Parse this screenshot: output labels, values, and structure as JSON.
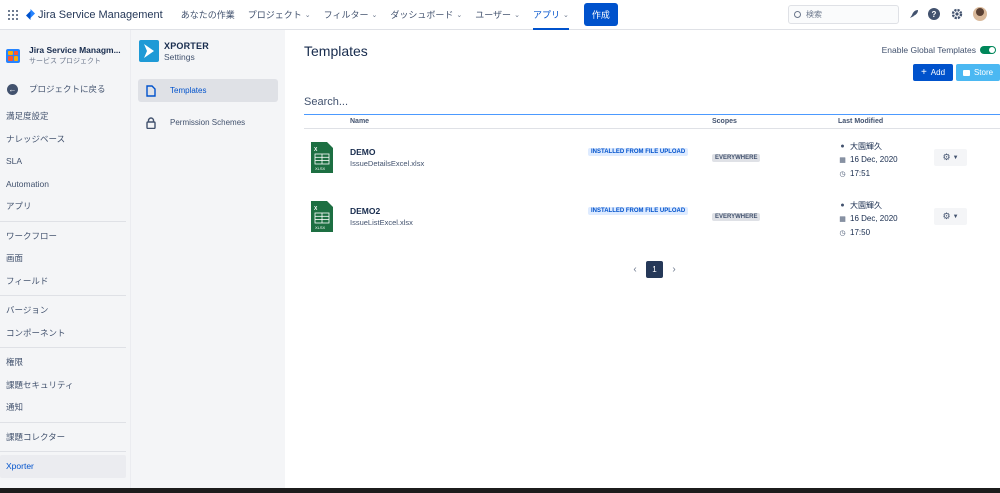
{
  "topbar": {
    "product_name": "Jira Service Management",
    "nav": [
      {
        "label": "あなたの作業",
        "chevron": false,
        "active": false
      },
      {
        "label": "プロジェクト",
        "chevron": true,
        "active": false
      },
      {
        "label": "フィルター",
        "chevron": true,
        "active": false
      },
      {
        "label": "ダッシュボード",
        "chevron": true,
        "active": false
      },
      {
        "label": "ユーザー",
        "chevron": true,
        "active": false
      },
      {
        "label": "アプリ",
        "chevron": true,
        "active": true
      }
    ],
    "create_label": "作成",
    "search_placeholder": "検索",
    "icons": [
      "apps-grid-icon",
      "rocket-icon",
      "help-icon",
      "settings-icon",
      "user-avatar"
    ]
  },
  "sidebar": {
    "project_name": "Jira Service Managm...",
    "project_type": "サービス プロジェクト",
    "back_label": "プロジェクトに戻る",
    "groups": [
      [
        "満足度設定",
        "ナレッジベース",
        "SLA",
        "Automation",
        "アプリ"
      ],
      [
        "ワークフロー",
        "画面",
        "フィールド"
      ],
      [
        "バージョン",
        "コンポーネント"
      ],
      [
        "権限",
        "課題セキュリティ",
        "通知"
      ],
      [
        "課題コレクター"
      ]
    ],
    "active_item": "Xporter"
  },
  "xporter": {
    "title": "XPORTER",
    "subtitle": "Settings",
    "menu": [
      {
        "label": "Templates",
        "icon": "document-icon",
        "active": true
      },
      {
        "label": "Permission Schemes",
        "icon": "lock-icon",
        "active": false
      }
    ]
  },
  "main": {
    "title": "Templates",
    "global_toggle_label": "Enable Global Templates",
    "global_toggle_on": true,
    "add_label": "Add",
    "store_label": "Store",
    "search_placeholder": "Search...",
    "columns": {
      "name": "Name",
      "scopes": "Scopes",
      "last_modified": "Last Modified"
    },
    "templates": [
      {
        "name": "DEMO",
        "file": "IssueDetailsExcel.xlsx",
        "badge": "INSTALLED FROM FILE UPLOAD",
        "scope": "EVERYWHERE",
        "user": "大園輝久",
        "date": "16 Dec, 2020",
        "time": "17:51"
      },
      {
        "name": "DEMO2",
        "file": "IssueListExcel.xlsx",
        "badge": "INSTALLED FROM FILE UPLOAD",
        "scope": "EVERYWHERE",
        "user": "大園輝久",
        "date": "16 Dec, 2020",
        "time": "17:50"
      }
    ],
    "pagination": {
      "current": "1"
    }
  },
  "colors": {
    "primary": "#0052cc",
    "store": "#4bb8f2",
    "toggle_on": "#00875a",
    "excel_green": "#1d6f42"
  }
}
